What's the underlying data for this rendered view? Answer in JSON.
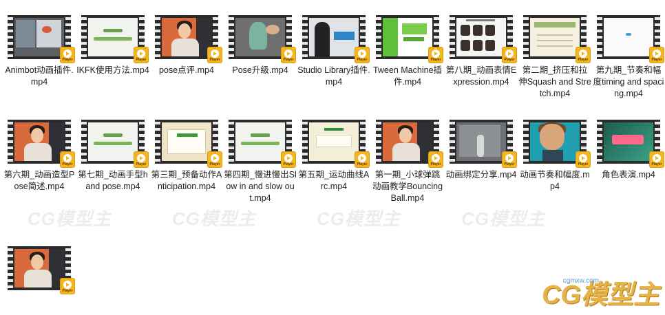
{
  "files": [
    {
      "label": "Animbot动画插件.mp4",
      "thumb": "screen"
    },
    {
      "label": "IKFK使用方法.mp4",
      "thumb": "paper"
    },
    {
      "label": "pose点评.mp4",
      "thumb": "person"
    },
    {
      "label": "Pose升级.mp4",
      "thumb": "3d"
    },
    {
      "label": "Studio Library插件.mp4",
      "thumb": "studio"
    },
    {
      "label": "Tween Machine插件.mp4",
      "thumb": "green"
    },
    {
      "label": "第八期_动画表情Expression.mp4",
      "thumb": "grid"
    },
    {
      "label": "第二期_挤压和拉伸Squash and Stretch.mp4",
      "thumb": "squash"
    },
    {
      "label": "第九期_节奏和幅度timing and spacing.mp4",
      "thumb": "blank"
    },
    {
      "label": "第六期_动画造型Pose简述.mp4",
      "thumb": "person"
    },
    {
      "label": "第七期_动画手型hand pose.mp4",
      "thumb": "paper"
    },
    {
      "label": "第三期_预备动作Anticipation.mp4",
      "thumb": "cream"
    },
    {
      "label": "第四期_慢进慢出Slow in and slow out.mp4",
      "thumb": "paper"
    },
    {
      "label": "第五期_运动曲线Arc.mp4",
      "thumb": "curl"
    },
    {
      "label": "第一期_小球弹跳动画教学Bouncing Ball.mp4",
      "thumb": "person"
    },
    {
      "label": "动画绑定分享.mp4",
      "thumb": "board"
    },
    {
      "label": "动画节奏和幅度.mp4",
      "thumb": "cartoon"
    },
    {
      "label": "角色表演.mp4",
      "thumb": "title"
    },
    {
      "label": "",
      "thumb": "person"
    }
  ],
  "badge_text": "Player",
  "watermark": {
    "text": "CG模型主",
    "url": "cgmxw.com"
  }
}
